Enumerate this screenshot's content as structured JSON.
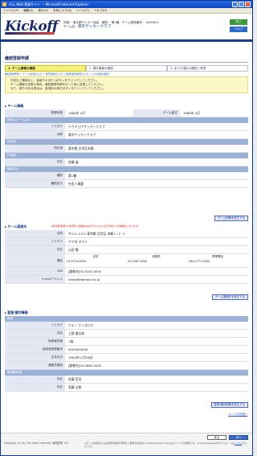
{
  "window": {
    "title": "ボム Web 登録サイト － Microsoft Internet Explorer",
    "menu": [
      "ファイル(F)",
      "編集(E)",
      "表示(V)",
      "お気に入り(A)",
      "ツール(T)",
      "ヘルプ(H)"
    ],
    "controls": [
      "_",
      "□",
      "×"
    ]
  },
  "header": {
    "logo": "Kickoff",
    "info_line": "所属： 東京都サッカー協会　種別： 第1種　チーム登録番号： 0000001",
    "team_label": "チーム名：",
    "team_name": "東京サッカークラブ",
    "btn_top": "終了",
    "btn_bottom": "ヘルプ"
  },
  "page": {
    "title": "継続登録申請",
    "steps": [
      "1. チーム情報の確認",
      "2. 選手情報の確認",
      "3. 全ての項目の確認と申請"
    ],
    "sub_note": "継続登録申請 > チーム情報の入力 > 選手情報の入力 > 監督/審判情報の入力 > 入力内容の確認",
    "notes": [
      "内容をご確認の上、画面下の[次へ]ボタンをクリックしてください。",
      "チーム情報の変更の場合、継続登録申請を行った後に変更してください。",
      "また、誤りがある場合は、各項目の修正ボタンをクリックしてください。"
    ]
  },
  "team_info": {
    "heading": "チーム情報",
    "founded_label": "登録年度",
    "founded": "1984年 4月",
    "estab_label": "チーム創立",
    "estab": "1984年 4月",
    "name_group": "団体名(チーム名)",
    "kana_label": "フリガナ",
    "kana": "トウキョウサッカークラブ",
    "name_label": "名称",
    "name": "東京サッカークラブ",
    "loc_group": "所在地",
    "loc_label": "所在地",
    "loc": "東京都 文京区本郷",
    "rep_group": "代表者",
    "rep_label": "氏名",
    "rep": "佐藤 進",
    "type_group": "種別区分",
    "type_label": "種別",
    "type": "第1種",
    "type2_label": "種別区分",
    "type2": "社会人連盟",
    "edit": "チーム情報を修正する"
  },
  "contact": {
    "heading": "チーム連絡先",
    "warn": "※担当者(監督)の住所及び連絡先は必ずボム(ボム窓口代表)への連絡先となります。",
    "addr_label": "住所",
    "addr": "〒111-1111 東京都 文京区 本郷1－1－1",
    "kana_label": "フリガナ",
    "kana": "ヤマダ タカシ",
    "name_label": "氏名",
    "name": "山田 隆",
    "phone_label": "電話",
    "phone_heads": [
      "自宅",
      "勤務先",
      "携帯電話"
    ],
    "phones": [
      "03-5714-0000",
      "03-5287-0000",
      "090-1777-0000"
    ],
    "fax_label": "FAX",
    "fax": "[勤務先]03-5287-0000",
    "mail_label": "e-mailアドレス",
    "mail": "name@domain.ne.jp",
    "edit": "チーム連絡先を修正する"
  },
  "staff": {
    "heading": "監督/審判情報",
    "group1": "監督",
    "kana_label": "フリガナ",
    "kana": "ウエノ ケンタロウ",
    "name_label": "氏名",
    "name": "上野 健太郎",
    "cert_label": "指導者資格",
    "cert": "C級",
    "num_label": "指導者登録番号",
    "num": "0000000000",
    "birth_label": "生年月日",
    "birth": "1961年12月08日",
    "tel_label": "連絡先電話",
    "tel": "[勤務先]03-5863-0000",
    "group2": "帯同審判員",
    "ref1_label": "氏名",
    "ref1": "佐藤 哲司",
    "ref2_label": "氏名",
    "ref2": "斎藤 太郎",
    "edit": "監督/審判情報を修正する",
    "top": "ページの先頭へ"
  },
  "footer": {
    "copy": "Copyright (c) ボム All rights reserved. 継続登録 112",
    "prev": "戻る",
    "next": "次へ",
    "note": "※チーム情報またはは選手情報の印刷をご希望の場合は Acrobat Reader 4.0以上のソフトが必要です。Acrobat Readerのダウンロードは",
    "link": "こちら",
    "note_tail": "からどうぞ。"
  }
}
